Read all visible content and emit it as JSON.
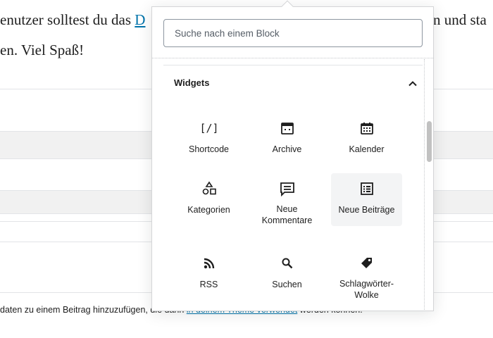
{
  "background": {
    "line1_prefix": "enutzer solltest du das ",
    "line1_link": "D",
    "line1_suffix": "n und sta",
    "line2": "en. Viel Spaß!",
    "help_prefix": "daten zu einem Beitrag hinzuzufügen, die dann ",
    "help_link": "in deinem Theme verwendet",
    "help_suffix": " werden können."
  },
  "inserter": {
    "search_placeholder": "Suche nach einem Block",
    "panel_title": "Widgets",
    "blocks": [
      {
        "label": "Shortcode",
        "icon": "shortcode-icon"
      },
      {
        "label": "Archive",
        "icon": "archive-icon"
      },
      {
        "label": "Kalender",
        "icon": "calendar-icon"
      },
      {
        "label": "Kategorien",
        "icon": "categories-icon"
      },
      {
        "label": "Neue Kommentare",
        "icon": "comment-icon"
      },
      {
        "label": "Neue Beiträge",
        "icon": "list-icon"
      },
      {
        "label": "RSS",
        "icon": "rss-icon"
      },
      {
        "label": "Suchen",
        "icon": "search-icon"
      },
      {
        "label": "Schlagwörter-Wolke",
        "icon": "tag-icon"
      }
    ]
  },
  "colors": {
    "text": "#1e1e1e",
    "link": "#0073aa",
    "hover_bg": "#f3f4f5",
    "border": "#d4d5d7"
  }
}
